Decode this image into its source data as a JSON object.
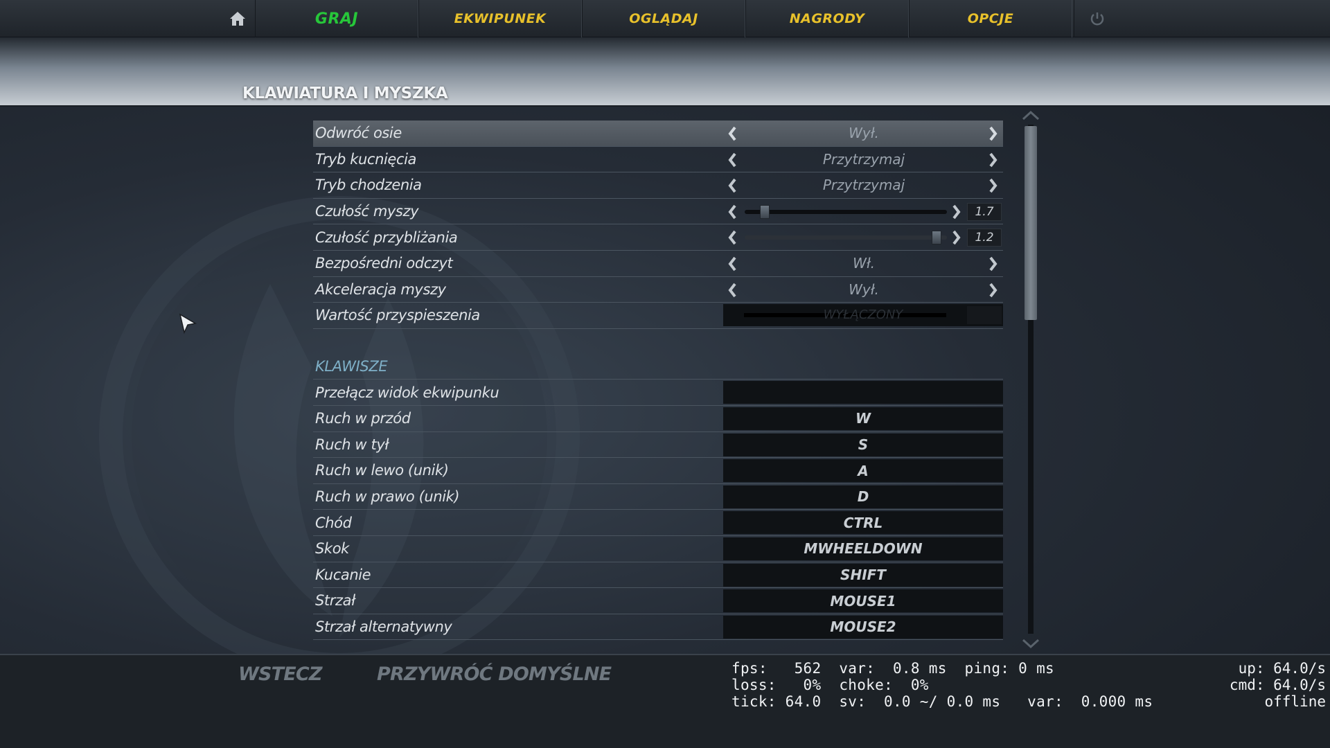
{
  "nav": {
    "tabs": [
      {
        "label": "GRAJ",
        "active": true
      },
      {
        "label": "EKWIPUNEK",
        "active": false
      },
      {
        "label": "OGLĄDAJ",
        "active": false
      },
      {
        "label": "NAGRODY",
        "active": false
      },
      {
        "label": "OPCJE",
        "active": false
      }
    ],
    "home_icon": "home-icon",
    "power_icon": "power-icon",
    "active_color": "#27c63a",
    "tab_color": "#e8c12b"
  },
  "page_title": "KLAWIATURA I MYSZKA",
  "mouse_settings": [
    {
      "label": "Odwróć osie",
      "type": "option",
      "value": "Wył.",
      "selected": true
    },
    {
      "label": "Tryb kucnięcia",
      "type": "option",
      "value": "Przytrzymaj"
    },
    {
      "label": "Tryb chodzenia",
      "type": "option",
      "value": "Przytrzymaj"
    },
    {
      "label": "Czułość myszy",
      "type": "slider",
      "value": "1.7",
      "level": 0.08
    },
    {
      "label": "Czułość przybliżania",
      "type": "slider",
      "value": "1.2",
      "level": 0.97
    },
    {
      "label": "Bezpośredni odczyt",
      "type": "option",
      "value": "Wł."
    },
    {
      "label": "Akceleracja myszy",
      "type": "option",
      "value": "Wył."
    },
    {
      "label": "Wartość przyspieszenia",
      "type": "disabled",
      "value": "WYŁĄCZONY"
    }
  ],
  "keys_section": {
    "title": "KLAWISZE",
    "bindings": [
      {
        "label": "Przełącz widok ekwipunku",
        "key": ""
      },
      {
        "label": "Ruch w przód",
        "key": "W"
      },
      {
        "label": "Ruch w tył",
        "key": "S"
      },
      {
        "label": "Ruch w lewo (unik)",
        "key": "A"
      },
      {
        "label": "Ruch w prawo (unik)",
        "key": "D"
      },
      {
        "label": "Chód",
        "key": "CTRL"
      },
      {
        "label": "Skok",
        "key": "MWHEELDOWN"
      },
      {
        "label": "Kucanie",
        "key": "SHIFT"
      },
      {
        "label": "Strzał",
        "key": "MOUSE1"
      },
      {
        "label": "Strzał alternatywny",
        "key": "MOUSE2"
      }
    ]
  },
  "footer": {
    "back_label": "WSTECZ",
    "reset_label": "PRZYWRÓĆ DOMYŚLNE"
  },
  "netgraph": {
    "line1": "fps:   562  var:  0.8 ms  ping: 0 ms",
    "line2": "loss:   0%  choke:  0%",
    "line3": "tick: 64.0  sv:  0.0 ~/ 0.0 ms   var:  0.000 ms",
    "right1": "up: 64.0/s",
    "right2": "cmd: 64.0/s",
    "right3": "offline"
  }
}
